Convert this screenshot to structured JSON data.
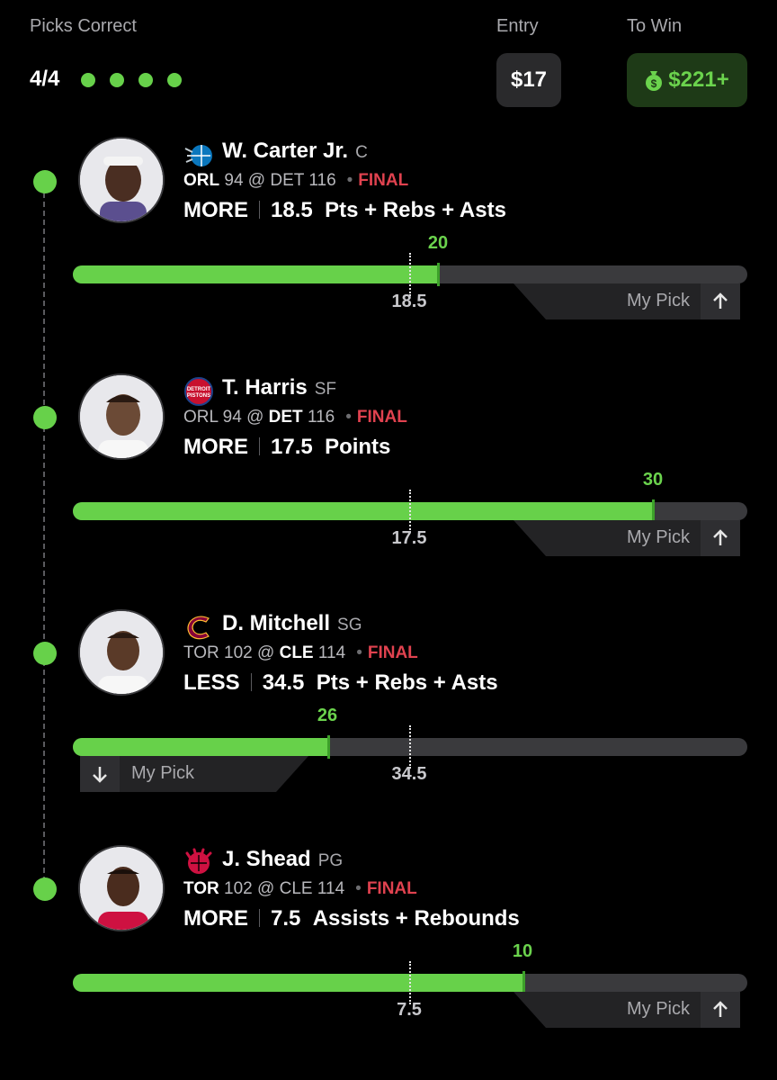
{
  "header": {
    "picks_label": "Picks Correct",
    "picks_count": "4/4",
    "picks_correct": 4,
    "picks_total": 4,
    "entry_label": "Entry",
    "entry_value": "$17",
    "win_label": "To Win",
    "win_value": "$221+"
  },
  "colors": {
    "accent": "#67d14a",
    "final": "#e0424f",
    "track": "#3a3a3d"
  },
  "my_pick_label": "My Pick",
  "final_label": "FINAL",
  "picks": [
    {
      "name": "W. Carter Jr.",
      "position": "C",
      "team_icon": "orlando-magic-logo-icon",
      "away": "ORL",
      "away_score": "94",
      "home": "DET",
      "home_score": "116",
      "direction": "MORE",
      "line": "18.5",
      "stat": "Pts + Rebs + Asts",
      "result": "20",
      "line_value": 18.5,
      "result_value": 20,
      "scale_max": 36.9
    },
    {
      "name": "T. Harris",
      "position": "SF",
      "team_icon": "detroit-pistons-logo-icon",
      "away": "ORL",
      "away_score": "94",
      "home": "DET",
      "home_score": "116",
      "direction": "MORE",
      "line": "17.5",
      "stat": "Points",
      "result": "30",
      "line_value": 17.5,
      "result_value": 30,
      "scale_max": 35
    },
    {
      "name": "D. Mitchell",
      "position": "SG",
      "team_icon": "cleveland-cavaliers-logo-icon",
      "away": "TOR",
      "away_score": "102",
      "home": "CLE",
      "home_score": "114",
      "direction": "LESS",
      "line": "34.5",
      "stat": "Pts + Rebs + Asts",
      "result": "26",
      "line_value": 34.5,
      "result_value": 26,
      "scale_max": 69
    },
    {
      "name": "J. Shead",
      "position": "PG",
      "team_icon": "toronto-raptors-logo-icon",
      "away": "TOR",
      "away_score": "102",
      "home": "CLE",
      "home_score": "114",
      "direction": "MORE",
      "line": "7.5",
      "stat": "Assists + Rebounds",
      "result": "10",
      "line_value": 7.5,
      "result_value": 10,
      "scale_max": 15
    }
  ]
}
